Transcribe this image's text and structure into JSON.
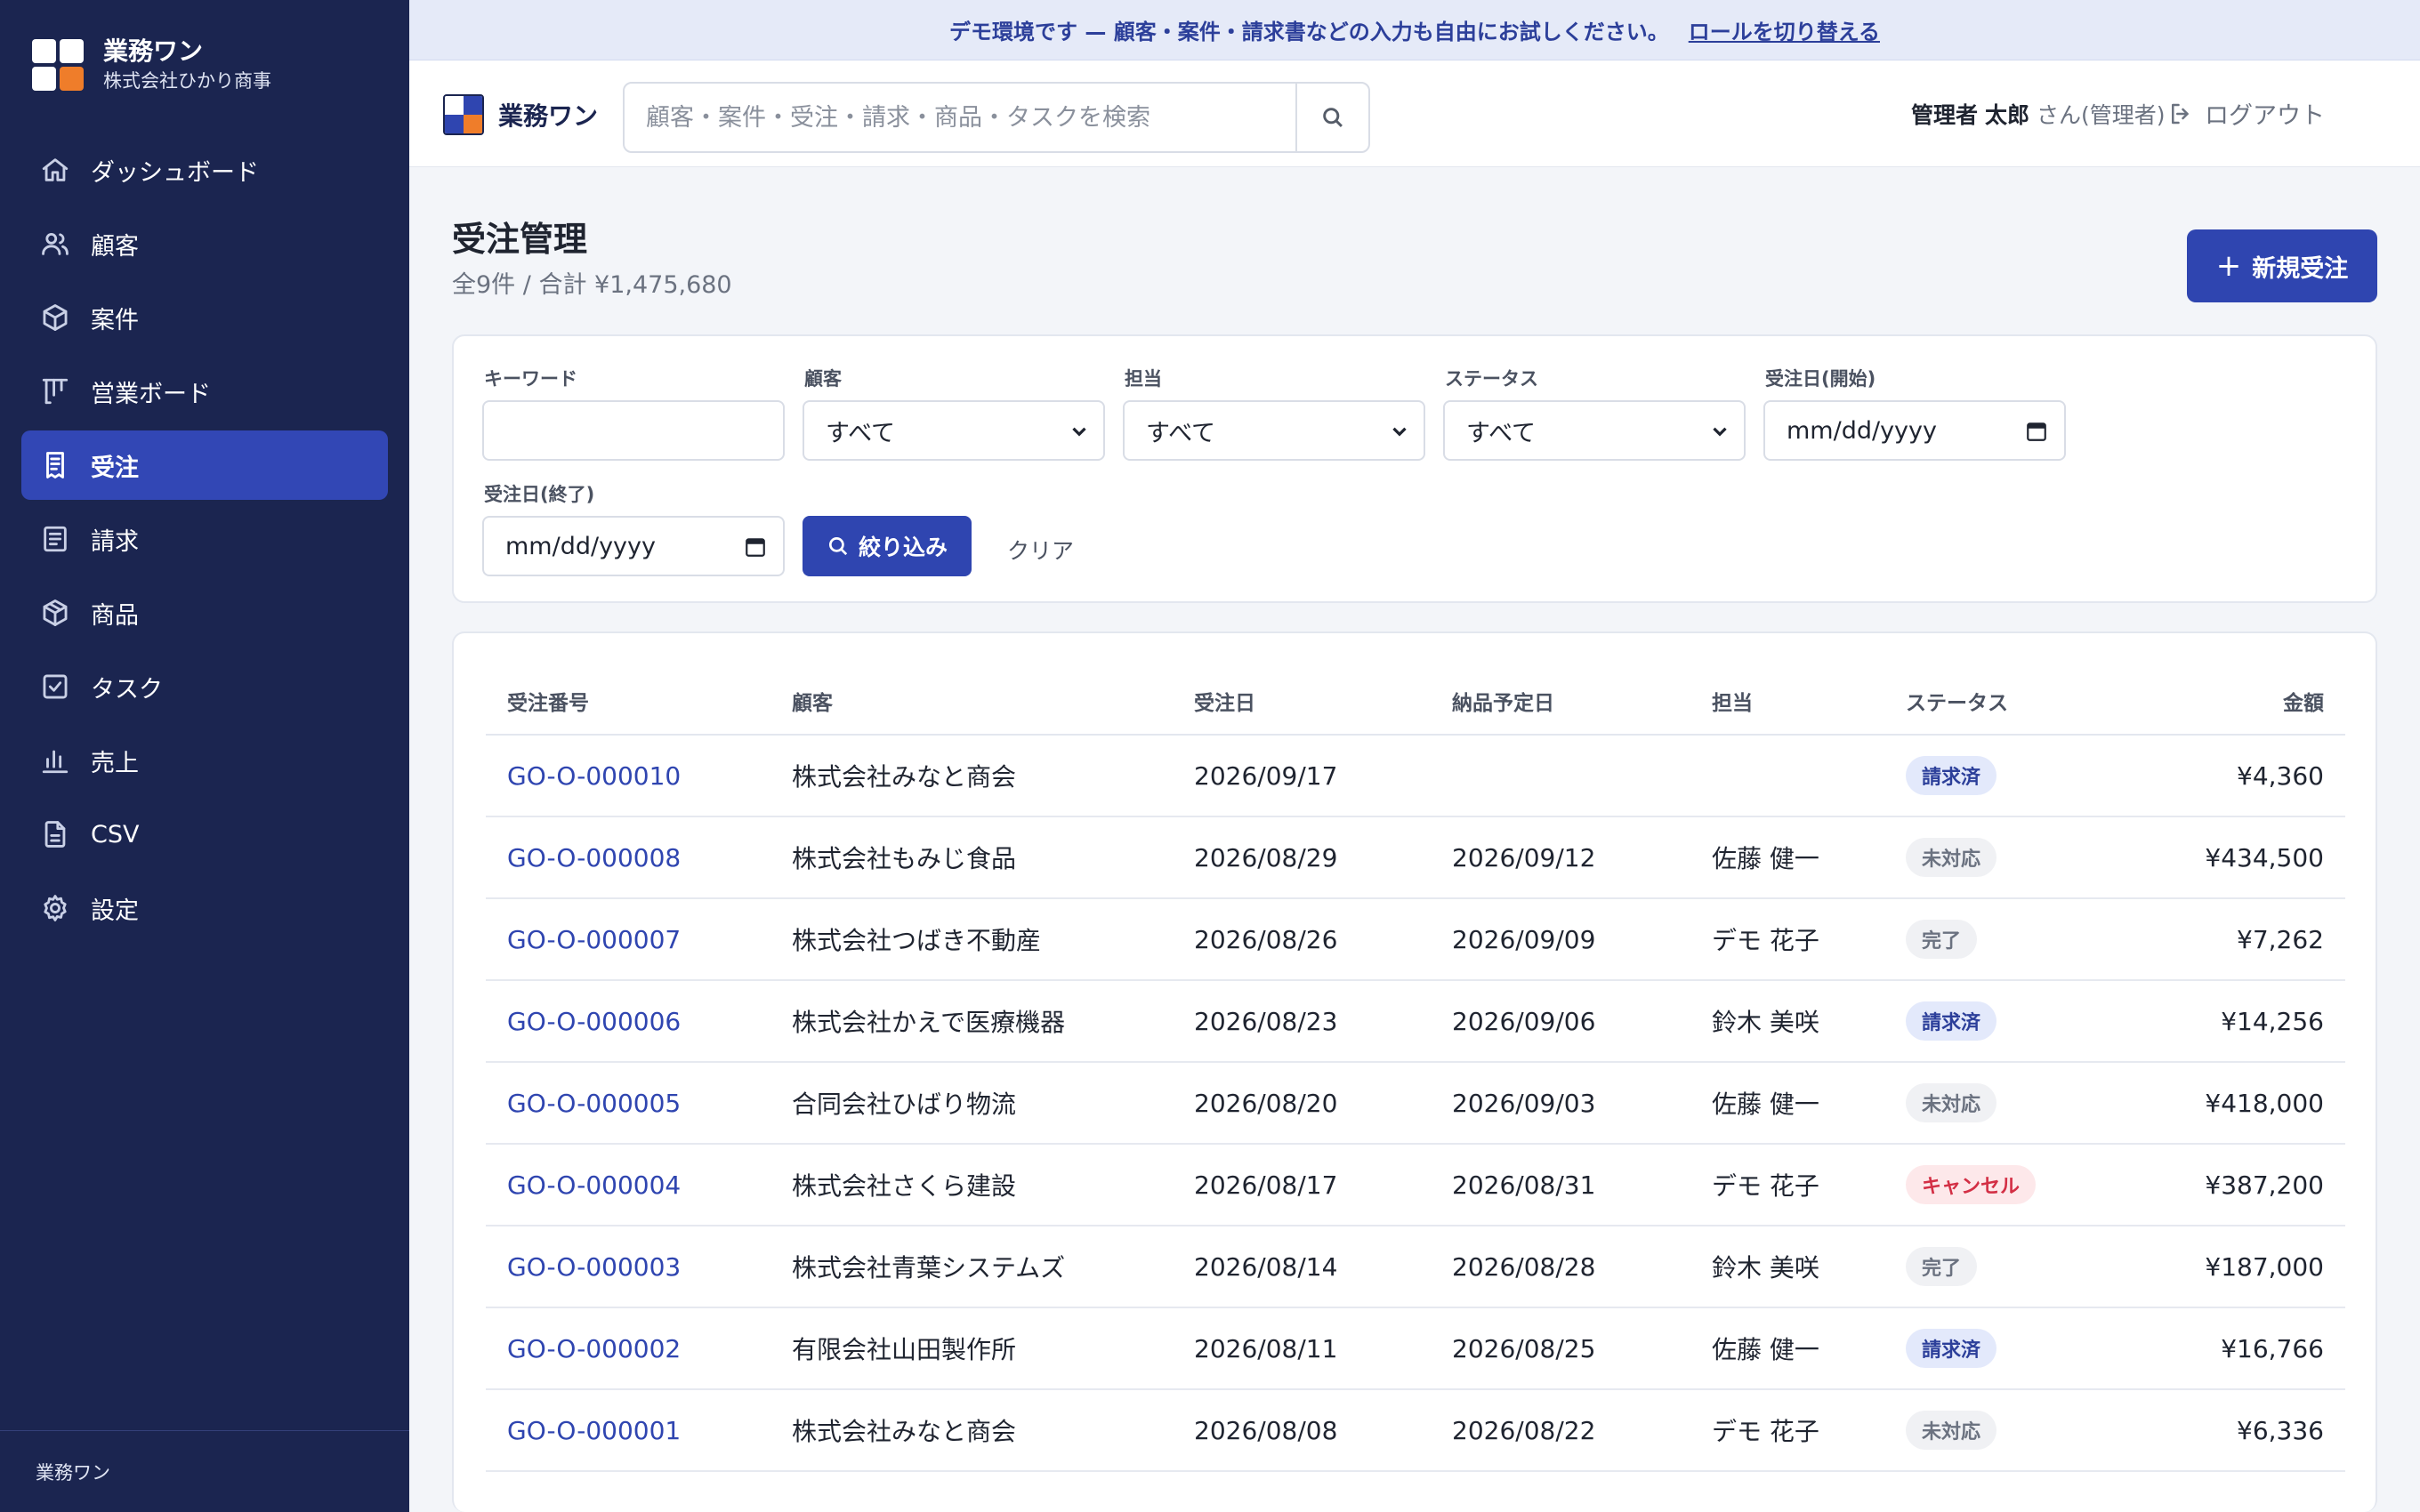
{
  "app": {
    "name": "業務ワン",
    "company": "株式会社ひかり商事",
    "footer": "業務ワン",
    "colors": {
      "sidebar": "#1b2550",
      "accent": "#2f45b0",
      "logo_blue": "#2f45b0",
      "logo_orange": "#ef7d2a"
    }
  },
  "banner": {
    "text": "デモ環境です — 顧客・案件・請求書などの入力も自由にお試しください。",
    "link": "ロールを切り替える"
  },
  "sidebar": {
    "items": [
      {
        "label": "ダッシュボード",
        "icon": "home-icon"
      },
      {
        "label": "顧客",
        "icon": "users-icon"
      },
      {
        "label": "案件",
        "icon": "box-icon"
      },
      {
        "label": "営業ボード",
        "icon": "kanban-icon"
      },
      {
        "label": "受注",
        "icon": "receipt-icon",
        "active": true
      },
      {
        "label": "請求",
        "icon": "invoice-icon"
      },
      {
        "label": "商品",
        "icon": "package-icon"
      },
      {
        "label": "タスク",
        "icon": "check-square-icon"
      },
      {
        "label": "売上",
        "icon": "bar-chart-icon"
      },
      {
        "label": "CSV",
        "icon": "file-icon"
      },
      {
        "label": "設定",
        "icon": "gear-icon"
      }
    ]
  },
  "topbar": {
    "brand": "業務ワン",
    "search_placeholder": "顧客・案件・受注・請求・商品・タスクを検索",
    "search_value": "",
    "user_role_prefix": "管理者",
    "user_name": "太郎",
    "user_suffix": "さん(管理者)",
    "logout": "ログアウト"
  },
  "page": {
    "title": "受注管理",
    "summary": "全9件 / 合計 ¥1,475,680",
    "new_button": "新規受注"
  },
  "filters": {
    "keyword_label": "キーワード",
    "keyword_value": "",
    "customer_label": "顧客",
    "customer_value": "すべて",
    "owner_label": "担当",
    "owner_value": "すべて",
    "status_label": "ステータス",
    "status_value": "すべて",
    "date_from_label": "受注日(開始)",
    "date_from_value": "mm/dd/yyyy",
    "date_to_label": "受注日(終了)",
    "date_to_value": "mm/dd/yyyy",
    "apply_button": "絞り込み",
    "clear_button": "クリア"
  },
  "table": {
    "columns": [
      "受注番号",
      "顧客",
      "受注日",
      "納品予定日",
      "担当",
      "ステータス",
      "金額"
    ],
    "rows": [
      {
        "order_no": "GO-O-000010",
        "customer": "株式会社みなと商会",
        "order_date": "2026/09/17",
        "delivery_date": "",
        "owner": "",
        "status": "請求済",
        "status_type": "invoiced",
        "amount": "¥4,360"
      },
      {
        "order_no": "GO-O-000008",
        "customer": "株式会社もみじ食品",
        "order_date": "2026/08/29",
        "delivery_date": "2026/09/12",
        "owner": "佐藤 健一",
        "status": "未対応",
        "status_type": "pending",
        "amount": "¥434,500"
      },
      {
        "order_no": "GO-O-000007",
        "customer": "株式会社つばき不動産",
        "order_date": "2026/08/26",
        "delivery_date": "2026/09/09",
        "owner": "デモ 花子",
        "status": "完了",
        "status_type": "done",
        "amount": "¥7,262"
      },
      {
        "order_no": "GO-O-000006",
        "customer": "株式会社かえで医療機器",
        "order_date": "2026/08/23",
        "delivery_date": "2026/09/06",
        "owner": "鈴木 美咲",
        "status": "請求済",
        "status_type": "invoiced",
        "amount": "¥14,256"
      },
      {
        "order_no": "GO-O-000005",
        "customer": "合同会社ひばり物流",
        "order_date": "2026/08/20",
        "delivery_date": "2026/09/03",
        "owner": "佐藤 健一",
        "status": "未対応",
        "status_type": "pending",
        "amount": "¥418,000"
      },
      {
        "order_no": "GO-O-000004",
        "customer": "株式会社さくら建設",
        "order_date": "2026/08/17",
        "delivery_date": "2026/08/31",
        "owner": "デモ 花子",
        "status": "キャンセル",
        "status_type": "cancel",
        "amount": "¥387,200"
      },
      {
        "order_no": "GO-O-000003",
        "customer": "株式会社青葉システムズ",
        "order_date": "2026/08/14",
        "delivery_date": "2026/08/28",
        "owner": "鈴木 美咲",
        "status": "完了",
        "status_type": "done",
        "amount": "¥187,000"
      },
      {
        "order_no": "GO-O-000002",
        "customer": "有限会社山田製作所",
        "order_date": "2026/08/11",
        "delivery_date": "2026/08/25",
        "owner": "佐藤 健一",
        "status": "請求済",
        "status_type": "invoiced",
        "amount": "¥16,766"
      },
      {
        "order_no": "GO-O-000001",
        "customer": "株式会社みなと商会",
        "order_date": "2026/08/08",
        "delivery_date": "2026/08/22",
        "owner": "デモ 花子",
        "status": "未対応",
        "status_type": "pending",
        "amount": "¥6,336"
      }
    ]
  }
}
